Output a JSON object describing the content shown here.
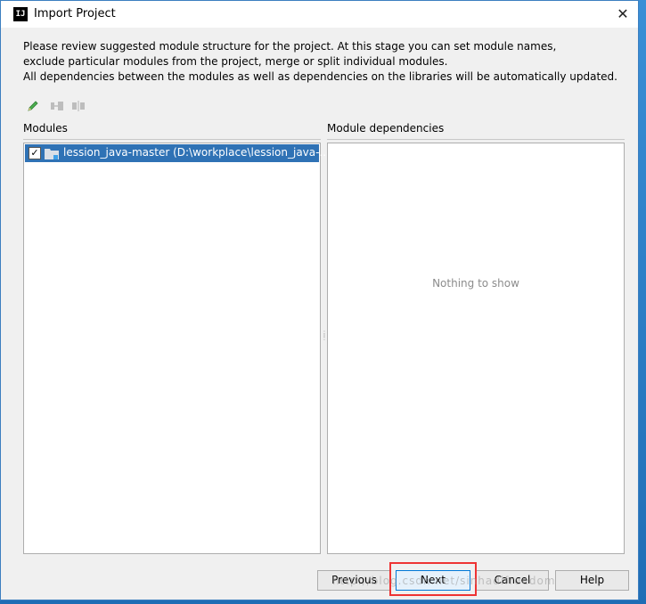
{
  "window": {
    "title": "Import Project",
    "app_icon_text": "IJ",
    "close": "✕"
  },
  "description": [
    "Please review suggested module structure for the project. At this stage you can set module names,",
    "exclude particular modules from the project, merge or split individual modules.",
    "All dependencies between the modules as well as dependencies on the libraries will be automatically updated."
  ],
  "toolbar": {
    "icons": [
      "edit-pencil-icon",
      "merge-modules-icon",
      "split-module-icon"
    ]
  },
  "modules": {
    "label": "Modules",
    "items": [
      {
        "name": "lession_java-master (D:\\workplace\\lession_java-...",
        "checked": true
      }
    ]
  },
  "dependencies": {
    "label": "Module dependencies",
    "empty_text": "Nothing to show"
  },
  "buttons": {
    "previous": "Previous",
    "next": "Next",
    "cancel": "Cancel",
    "help": "Help"
  },
  "watermark": "http://blog.csdn.net/sinhadifreedom",
  "colors": {
    "selection": "#2f72b5",
    "highlight_box": "#e33333",
    "empty_text": "#8c8c8c"
  }
}
